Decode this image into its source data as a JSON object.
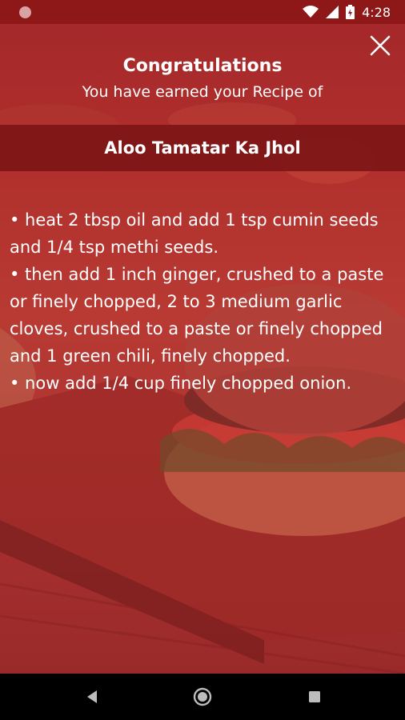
{
  "status_bar": {
    "time": "4:28",
    "icons": [
      "notification-dot-icon",
      "wifi-icon",
      "signal-icon",
      "battery-icon"
    ]
  },
  "dialog": {
    "congrats_title": "Congratulations",
    "earned_text": "You have earned your Recipe of",
    "recipe_name": "Aloo Tamatar Ka Jhol",
    "close_icon": "close-icon",
    "steps": [
      "• heat 2 tbsp oil and add 1 tsp cumin seeds and 1/4 tsp methi seeds.",
      "• then add 1 inch ginger, crushed to a paste or finely chopped, 2 to 3 medium garlic cloves, crushed to a paste or finely chopped and 1 green chili, finely chopped.",
      "• now add 1/4 cup finely chopped onion."
    ]
  },
  "nav_bar": {
    "icons": [
      "back-icon",
      "home-icon",
      "recents-icon"
    ]
  },
  "colors": {
    "status_bar": "#8e1717",
    "overlay": "#a5282a",
    "band": "#7d1616",
    "text": "#ffffff"
  }
}
